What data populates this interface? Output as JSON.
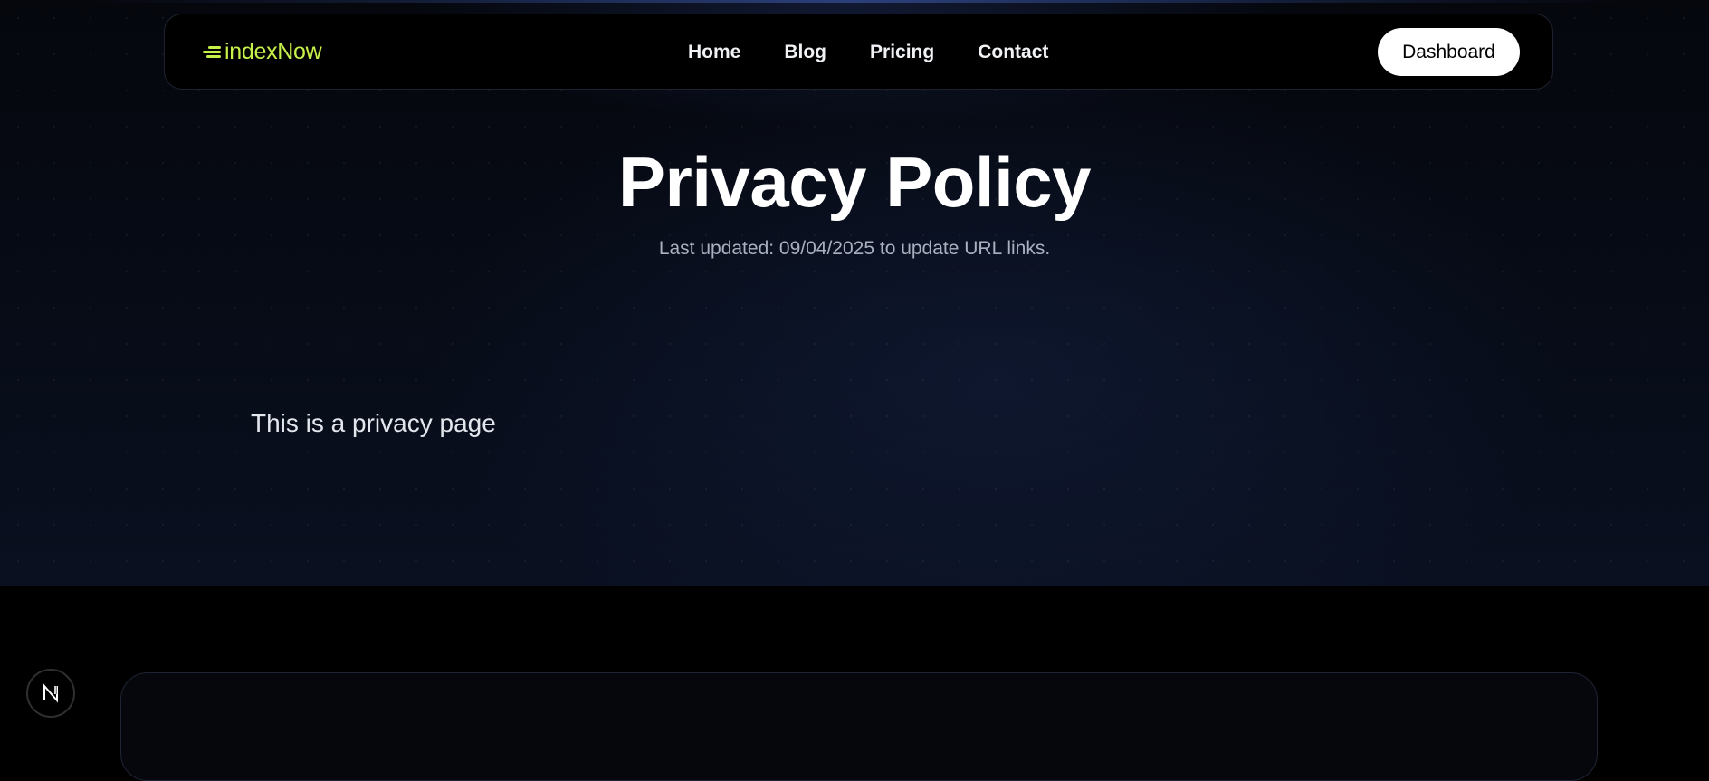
{
  "navbar": {
    "logo_text": "indexNow",
    "links": [
      {
        "label": "Home"
      },
      {
        "label": "Blog"
      },
      {
        "label": "Pricing"
      },
      {
        "label": "Contact"
      }
    ],
    "dashboard_label": "Dashboard"
  },
  "page": {
    "title": "Privacy Policy",
    "last_updated": "Last updated: 09/04/2025 to update URL links.",
    "body": "This is a privacy page"
  },
  "dev_badge": {
    "icon": "nextjs-n-icon"
  },
  "colors": {
    "accent": "#c6f04a",
    "background": "#000000",
    "hero_bg": "#070c18",
    "button_bg": "#ffffff"
  }
}
